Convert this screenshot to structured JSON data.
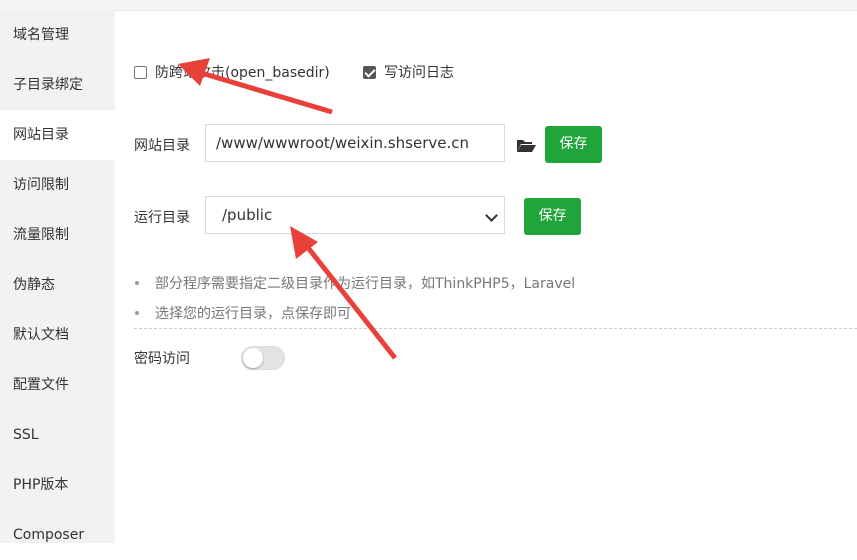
{
  "sidebar": {
    "items": [
      {
        "label": "域名管理",
        "active": false
      },
      {
        "label": "子目录绑定",
        "active": false
      },
      {
        "label": "网站目录",
        "active": true
      },
      {
        "label": "访问限制",
        "active": false
      },
      {
        "label": "流量限制",
        "active": false
      },
      {
        "label": "伪静态",
        "active": false
      },
      {
        "label": "默认文档",
        "active": false
      },
      {
        "label": "配置文件",
        "active": false
      },
      {
        "label": "SSL",
        "active": false
      },
      {
        "label": "PHP版本",
        "active": false
      },
      {
        "label": "Composer",
        "active": false
      }
    ]
  },
  "options": {
    "open_basedir_label": "防跨站攻击(open_basedir)",
    "open_basedir_checked": false,
    "access_log_label": "写访问日志",
    "access_log_checked": true
  },
  "site_dir": {
    "label": "网站目录",
    "value": "/www/wwwroot/weixin.shserve.cn",
    "save_label": "保存"
  },
  "run_dir": {
    "label": "运行目录",
    "value": "/public",
    "save_label": "保存"
  },
  "tips": [
    "部分程序需要指定二级目录作为运行目录，如ThinkPHP5，Laravel",
    "选择您的运行目录，点保存即可"
  ],
  "password_access": {
    "label": "密码访问",
    "enabled": false
  },
  "colors": {
    "primary_green": "#20a53a",
    "annotation_red": "#e8413a",
    "sidebar_bg": "#f2f2f2"
  }
}
